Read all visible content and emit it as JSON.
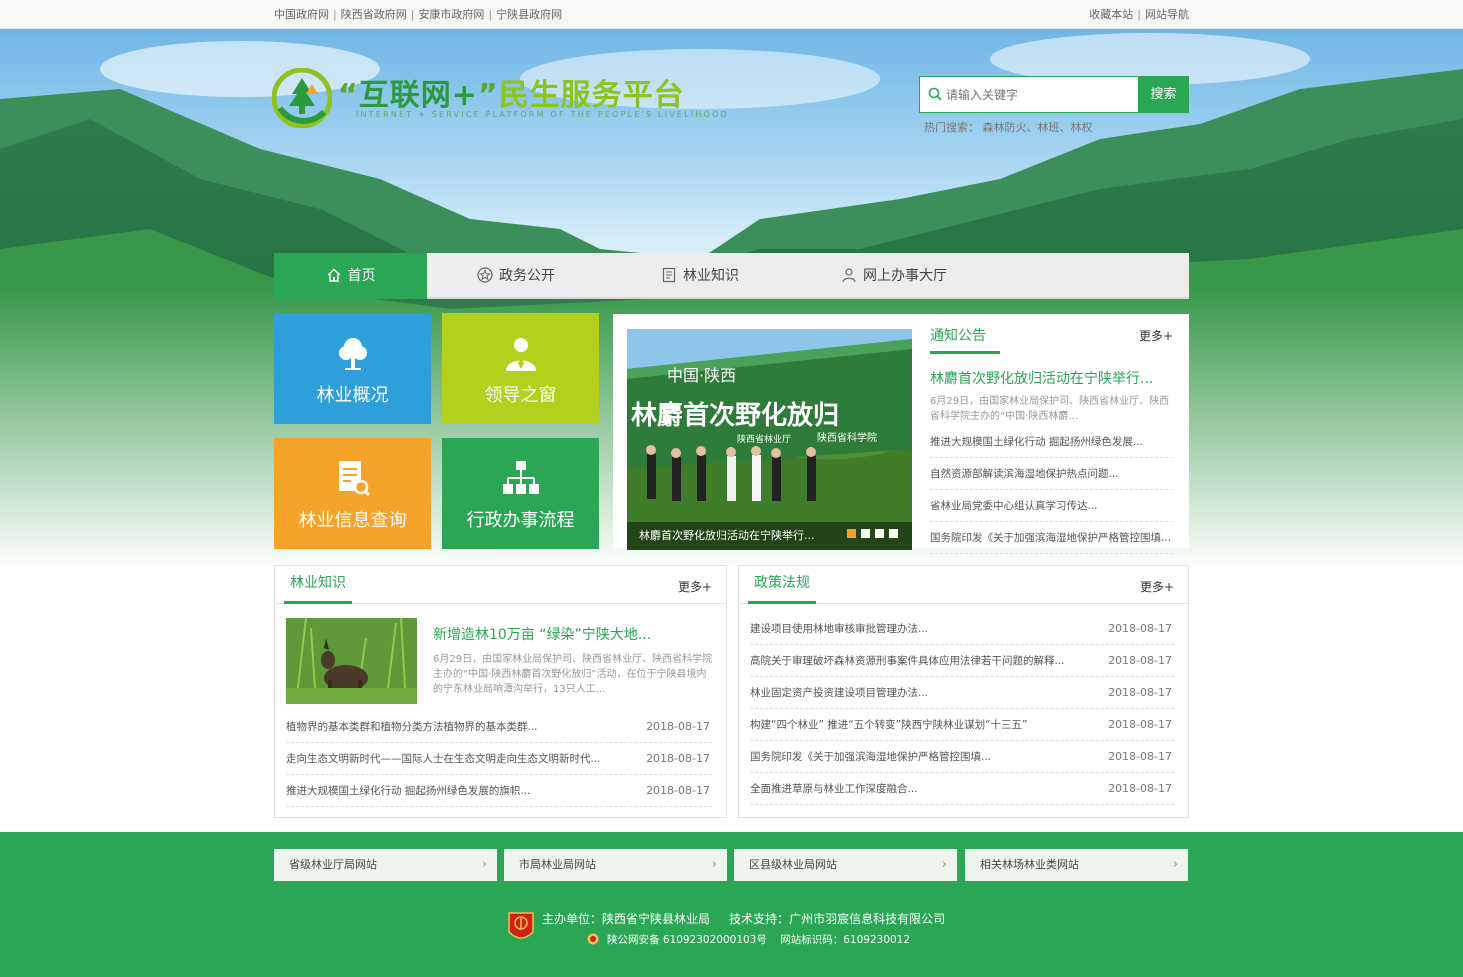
{
  "topbar": {
    "left_links": [
      "中国政府网",
      "陕西省政府网",
      "安康市政府网",
      "宁陕县政府网"
    ],
    "right_links": [
      "收藏本站",
      "网站导航"
    ]
  },
  "header": {
    "logo_title_open": "“",
    "logo_title_a": "互联网+",
    "logo_title_close": "”",
    "logo_title_b": "民生服务平台",
    "logo_subtitle": "INTERNET + SERVICE PLATFORM OF THE PEOPLE'S LIVELIHOOD",
    "search_placeholder": "请输入关键字",
    "search_button": "搜索",
    "hot_label": "热门搜索：",
    "hot_terms": "森林防火、林班、林权"
  },
  "nav": {
    "items": [
      {
        "label": "首页",
        "icon": "home-icon"
      },
      {
        "label": "政务公开",
        "icon": "star-icon"
      },
      {
        "label": "林业知识",
        "icon": "document-icon"
      },
      {
        "label": "网上办事大厅",
        "icon": "user-icon"
      }
    ]
  },
  "tiles": [
    {
      "label": "林业概况",
      "color": "#2e9fd8",
      "icon": "tree-icon"
    },
    {
      "label": "领导之窗",
      "color": "#b5cf1f",
      "icon": "leader-icon"
    },
    {
      "label": "林业信息查询",
      "color": "#f5a32b",
      "icon": "search-document-icon"
    },
    {
      "label": "行政办事流程",
      "color": "#2aa654",
      "icon": "flowchart-icon"
    }
  ],
  "slider": {
    "caption": "林麝首次野化放归活动在宁陕举行...",
    "banner_text": "林麝首次野化放归",
    "banner_top": "中国·陕西",
    "banner_org": "陕西省科学院",
    "banner_org2": "陕西省林业厅",
    "dots": 4,
    "active_dot": 1
  },
  "notice": {
    "title": "通知公告",
    "more": "更多+",
    "head_title": "林麝首次野化放归活动在宁陕举行...",
    "head_desc": "6月29日，由国家林业局保护司、陕西省林业厅、陕西省科学院主办的“中国·陕西林麝...",
    "items": [
      "推进大规模国土绿化行动 掘起扬州绿色发展...",
      "自然资源部解读滨海湿地保护热点问题...",
      "省林业局党委中心组认真学习传达...",
      "国务院印发《关于加强滨海湿地保护严格管控围填..."
    ]
  },
  "knowledge": {
    "title": "林业知识",
    "more": "更多+",
    "feature_title": "新增造林10万亩 “绿染”宁陕大地...",
    "feature_desc": "6月29日，由国家林业局保护司、陕西省林业厅、陕西省科学院主办的“中国·陕西林麝首次野化放归”活动，在位于宁陕县境内的宁东林业局响潭沟举行，13只人工...",
    "items": [
      {
        "text": "植物界的基本类群和植物分类方法植物界的基本类群...",
        "date": "2018-08-17"
      },
      {
        "text": "走向生态文明新时代——国际人士在生态文明走向生态文明新时代...",
        "date": "2018-08-17"
      },
      {
        "text": "推进大规模国土绿化行动 掘起扬州绿色发展的旗帜...",
        "date": "2018-08-17"
      }
    ]
  },
  "policy": {
    "title": "政策法规",
    "more": "更多+",
    "items": [
      {
        "text": "建设项目使用林地审核审批管理办法...",
        "date": "2018-08-17"
      },
      {
        "text": "高院关于审理破坏森林资源刑事案件具体应用法律若干问题的解释...",
        "date": "2018-08-17"
      },
      {
        "text": "林业固定资产投资建设项目管理办法...",
        "date": "2018-08-17"
      },
      {
        "text": "构建“四个林业” 推进“五个转变”陕西宁陕林业谋划“十三五”",
        "date": "2018-08-17"
      },
      {
        "text": "国务院印发《关于加强滨海湿地保护严格管控围填...",
        "date": "2018-08-17"
      },
      {
        "text": "全面推进草原与林业工作深度融合...",
        "date": "2018-08-17"
      }
    ]
  },
  "footer": {
    "links": [
      "省级林业厅局网站",
      "市局林业局网站",
      "区县级林业局网站",
      "相关林场林业类网站"
    ],
    "host": "主办单位：陕西省宁陕县林业局",
    "tech": "技术支持：广州市羽宸信息科技有限公司",
    "police_record": "陕公网安备 61092302000103号",
    "site_id": "网站标识码：6109230012"
  },
  "colors": {
    "brand_green": "#2aa654",
    "tile_blue": "#2e9fd8",
    "tile_lime": "#b5cf1f",
    "tile_orange": "#f5a32b"
  }
}
